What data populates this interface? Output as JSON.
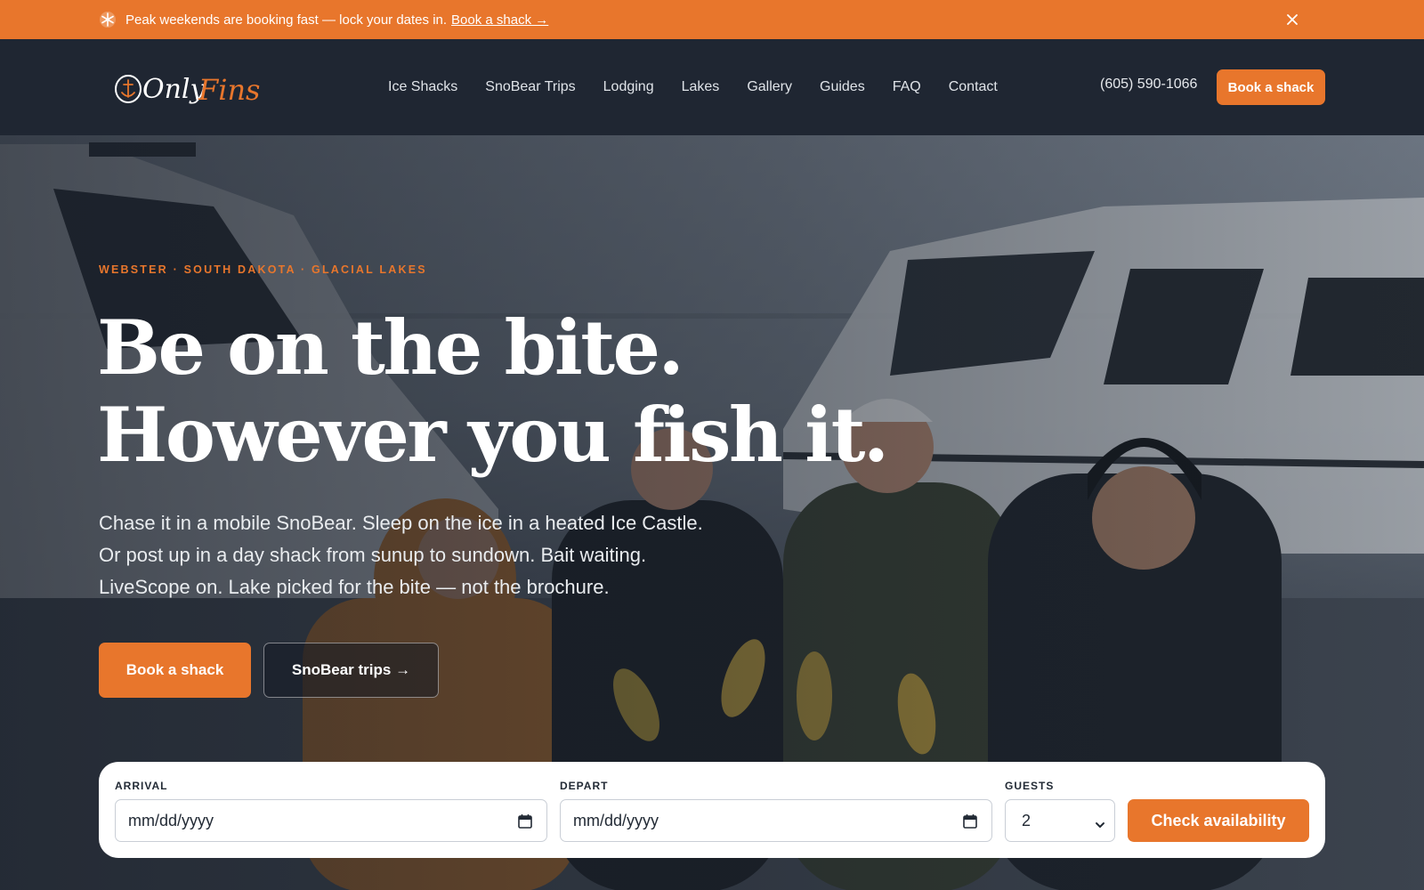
{
  "announcement": {
    "text": "Peak weekends are booking fast — lock your dates in.",
    "link": "Book a shack →",
    "icon": "snowflake-icon",
    "close_icon": "close-icon"
  },
  "brand": {
    "logo_text_1": "Only",
    "logo_text_2": "Fins",
    "accent": "#e8762c",
    "nav_bg": "#1f2632"
  },
  "nav": {
    "links": [
      "Ice Shacks",
      "SnoBear Trips",
      "Lodging",
      "Lakes",
      "Gallery",
      "Guides",
      "FAQ",
      "Contact"
    ],
    "phone": "(605) 590-1066",
    "cta": "Book a shack"
  },
  "hero": {
    "eyebrow": "WEBSTER · SOUTH DAKOTA · GLACIAL LAKES",
    "headline_1": "Be on the bite.",
    "headline_2": "However you fish it.",
    "sub_1": "Chase it in a mobile SnoBear. Sleep on the ice in a heated Ice Castle.",
    "sub_2": "Or post up in a day shack from sunup to sundown. Bait waiting.",
    "sub_3": "LiveScope on. Lake picked for the bite — not the brochure.",
    "primary_cta": "Book a shack",
    "secondary_cta": "SnoBear trips →"
  },
  "booking": {
    "arrival_label": "ARRIVAL",
    "arrival_placeholder": "mm/dd/yyyy",
    "depart_label": "DEPART",
    "depart_placeholder": "mm/dd/yyyy",
    "guests_label": "GUESTS",
    "guests_value": "2",
    "submit": "Check availability"
  }
}
